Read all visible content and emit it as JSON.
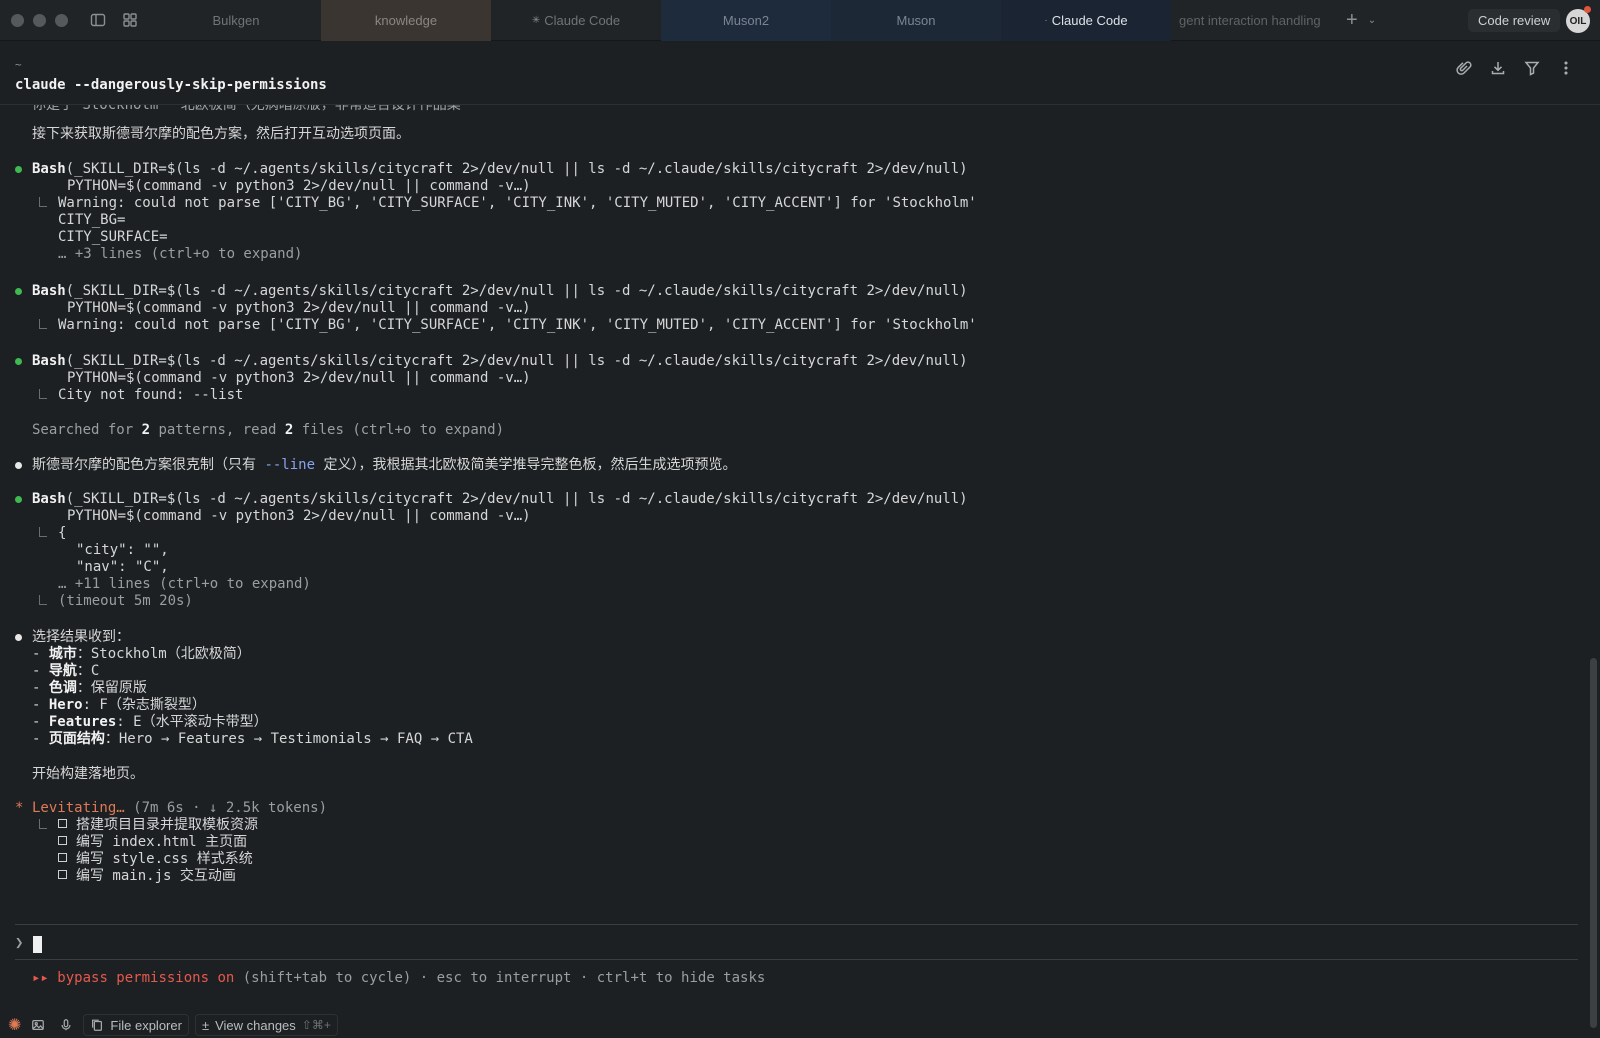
{
  "titlebar": {
    "tabs": [
      {
        "label": "Bulkgen"
      },
      {
        "label": "knowledge"
      },
      {
        "label": "Claude Code"
      },
      {
        "label": "Muson2"
      },
      {
        "label": "Muson"
      },
      {
        "label": "Claude Code"
      },
      {
        "label": "gent interaction handling"
      }
    ],
    "code_review": "Code review",
    "avatar_initials": "OIL"
  },
  "terminal": {
    "tilde": "~",
    "title": "claude --dangerously-skip-permissions",
    "cut_line": "你是了 Stockholm 一北欧极简（无病暗原版，非常适合设计作品集",
    "intro": "接下来获取斯德哥尔摩的配色方案，然后打开互动选项页面。",
    "bash1": {
      "cmd_name": "Bash",
      "cmd": "(_SKILL_DIR=$(ls -d ~/.agents/skills/citycraft 2>/dev/null || ls -d ~/.claude/skills/citycraft 2>/dev/null)",
      "cmd2": "PYTHON=$(command -v python3 2>/dev/null || command -v…)",
      "out1": "Warning: could not parse ['CITY_BG', 'CITY_SURFACE', 'CITY_INK', 'CITY_MUTED', 'CITY_ACCENT'] for 'Stockholm'",
      "out2": "CITY_BG=",
      "out3": "CITY_SURFACE=",
      "more": "… +3 lines (ctrl+o to expand)"
    },
    "bash2": {
      "cmd_name": "Bash",
      "cmd": "(_SKILL_DIR=$(ls -d ~/.agents/skills/citycraft 2>/dev/null || ls -d ~/.claude/skills/citycraft 2>/dev/null)",
      "cmd2": "PYTHON=$(command -v python3 2>/dev/null || command -v…)",
      "out1": "Warning: could not parse ['CITY_BG', 'CITY_SURFACE', 'CITY_INK', 'CITY_MUTED', 'CITY_ACCENT'] for 'Stockholm'"
    },
    "bash3": {
      "cmd_name": "Bash",
      "cmd": "(_SKILL_DIR=$(ls -d ~/.agents/skills/citycraft 2>/dev/null || ls -d ~/.claude/skills/citycraft 2>/dev/null)",
      "cmd2": "PYTHON=$(command -v python3 2>/dev/null || command -v…)",
      "out1": "City not found: --list"
    },
    "searched": {
      "pre": "Searched for ",
      "n1": "2",
      "mid": " patterns, read ",
      "n2": "2",
      "post": " files (ctrl+o to expand)"
    },
    "note": {
      "pre": "斯德哥尔摩的配色方案很克制（只有 ",
      "code": "--line",
      "post": " 定义），我根据其北欧极简美学推导完整色板，然后生成选项预览。"
    },
    "bash4": {
      "cmd_name": "Bash",
      "cmd": "(_SKILL_DIR=$(ls -d ~/.agents/skills/citycraft 2>/dev/null || ls -d ~/.claude/skills/citycraft 2>/dev/null)",
      "cmd2": "PYTHON=$(command -v python3 2>/dev/null || command -v…)",
      "out1": "{",
      "out2": "\"city\": \"\",",
      "out3": "\"nav\": \"C\",",
      "more": "… +11 lines (ctrl+o to expand)",
      "timeout": "(timeout 5m 20s)"
    },
    "result": {
      "heading": "选择结果收到：",
      "items": [
        {
          "key": "城市",
          "value": "：Stockholm（北欧极简）"
        },
        {
          "key": "导航",
          "value": "：C"
        },
        {
          "key": "色调",
          "value": "：保留原版"
        },
        {
          "key": "Hero",
          "value": ": F（杂志撕裂型）"
        },
        {
          "key": "Features",
          "value": ": E（水平滚动卡带型）"
        },
        {
          "key": "页面结构",
          "value": "：Hero → Features → Testimonials → FAQ → CTA"
        }
      ],
      "dash": "- ",
      "closing": "开始构建落地页。"
    },
    "working": {
      "star": "*",
      "label": "Levitating…",
      "stats": " (7m 6s · ↓ 2.5k tokens)",
      "tasks": [
        "搭建项目目录并提取模板资源",
        "编写 index.html 主页面",
        "编写 style.css 样式系统",
        "编写 main.js 交互动画"
      ]
    },
    "prompt_symbol": "❯",
    "status": {
      "arrows": "▸▸",
      "mode": "bypass permissions on",
      "rest": " (shift+tab to cycle) · esc to interrupt · ctrl+t to hide tasks"
    }
  },
  "bottombar": {
    "file_explorer": "File explorer",
    "view_changes": "View changes",
    "view_changes_kbd": "⇧⌘+"
  }
}
